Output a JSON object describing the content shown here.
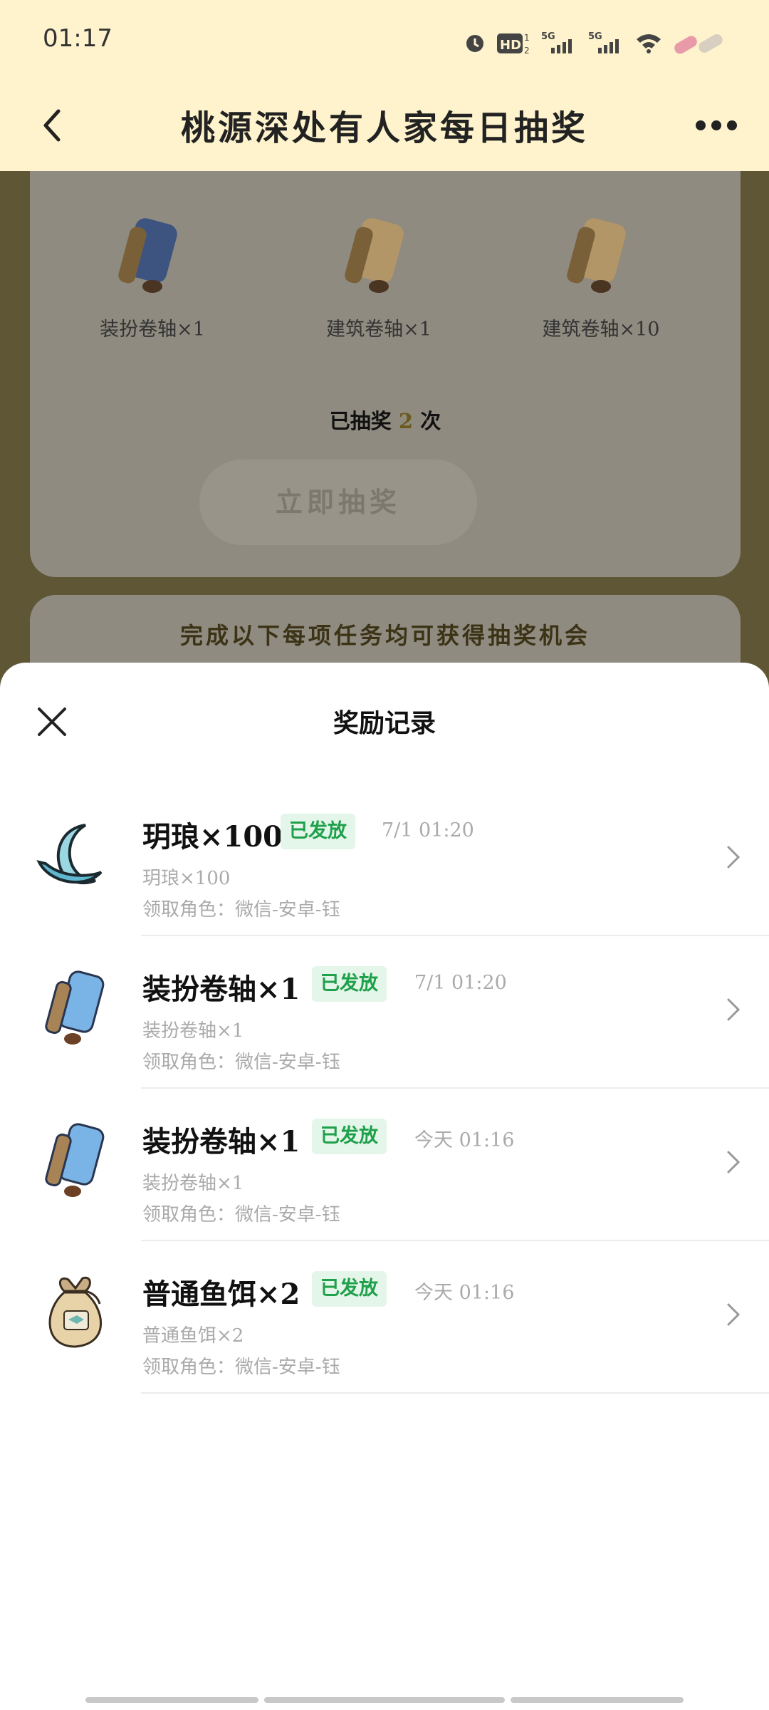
{
  "status_bar": {
    "time": "01:17",
    "icons": [
      "alarm-icon",
      "hd-icon",
      "signal-5g-icon",
      "signal-5g-icon",
      "wifi-icon",
      "notification-icon"
    ]
  },
  "nav": {
    "title": "桃源深处有人家每日抽奖",
    "back_icon": "chevron-left-icon",
    "more_icon": "more-dots-icon"
  },
  "lottery": {
    "prizes": [
      {
        "label": "装扮卷轴×1",
        "icon": "blue-scroll-icon"
      },
      {
        "label": "建筑卷轴×1",
        "icon": "orange-scroll-icon"
      },
      {
        "label": "建筑卷轴×10",
        "icon": "orange-scroll-icon"
      }
    ],
    "draw_count_prefix": "已抽奖",
    "draw_count_value": "2",
    "draw_count_suffix": "次",
    "draw_button": "立即抽奖"
  },
  "tasks": {
    "title": "完成以下每项任务均可获得抽奖机会"
  },
  "sheet": {
    "title": "奖励记录",
    "close_icon": "close-icon",
    "records": [
      {
        "title": "玥琅×100",
        "badge": "已发放",
        "time": "7/1 01:20",
        "sub": "玥琅×100",
        "role": "领取角色：微信-安卓-钰",
        "icon": "moon-icon"
      },
      {
        "title": "装扮卷轴×1",
        "badge": "已发放",
        "time": "7/1 01:20",
        "sub": "装扮卷轴×1",
        "role": "领取角色：微信-安卓-钰",
        "icon": "blue-scroll-icon"
      },
      {
        "title": "装扮卷轴×1",
        "badge": "已发放",
        "time": "今天 01:16",
        "sub": "装扮卷轴×1",
        "role": "领取角色：微信-安卓-钰",
        "icon": "blue-scroll-icon"
      },
      {
        "title": "普通鱼饵×2",
        "badge": "已发放",
        "time": "今天 01:16",
        "sub": "普通鱼饵×2",
        "role": "领取角色：微信-安卓-钰",
        "icon": "bait-bag-icon"
      }
    ]
  },
  "colors": {
    "header_bg": "#fef3cc",
    "badge_bg": "#e4f6ea",
    "badge_text": "#1fa04a",
    "overlay": "#5f5636"
  }
}
